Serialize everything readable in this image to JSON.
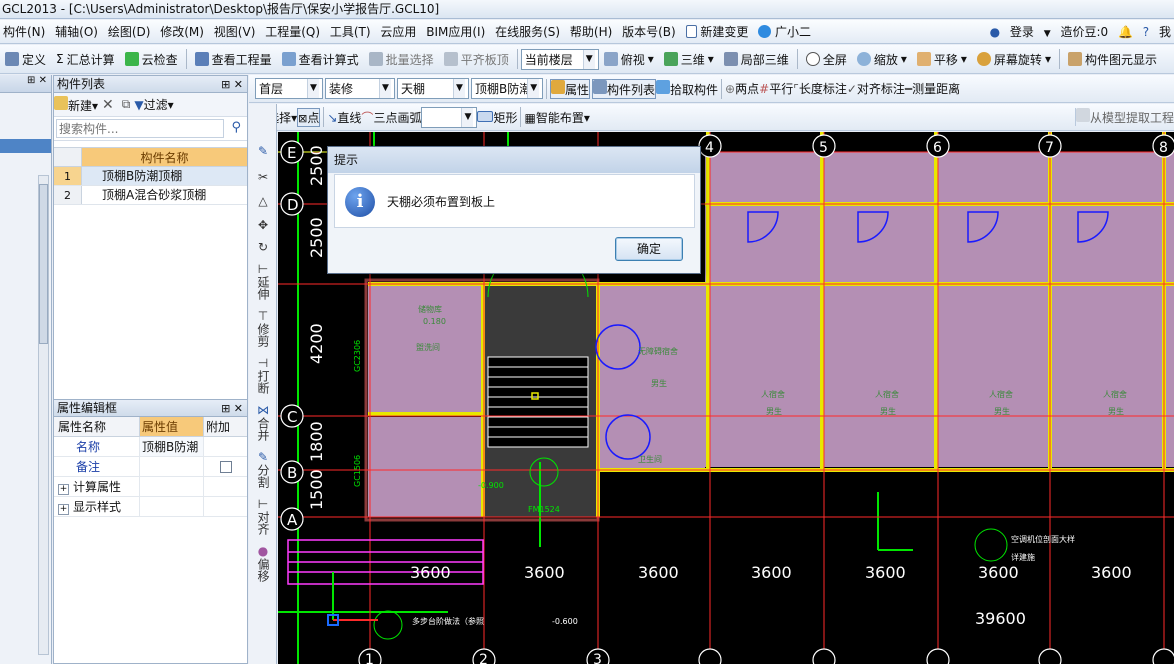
{
  "window": {
    "title": "GCL2013 - [C:\\Users\\Administrator\\Desktop\\报告厅\\保安小学报告厅.GCL10]"
  },
  "menu": {
    "items": [
      "构件(N)",
      "辅轴(O)",
      "绘图(D)",
      "修改(M)",
      "视图(V)",
      "工程量(Q)",
      "工具(T)",
      "云应用",
      "BIM应用(I)",
      "在线服务(S)",
      "帮助(H)",
      "版本号(B)",
      "新建变更",
      "广小二"
    ],
    "login": "登录",
    "cost_beans": "造价豆:0",
    "me": "我"
  },
  "toolbar1": {
    "define": "定义",
    "summary": "汇总计算",
    "cloud_check": "云检查",
    "view_quantity": "查看工程量",
    "view_formula": "查看计算式",
    "batch_select": "批量选择",
    "flush_slab": "平齐板顶",
    "floor_value": "当前楼层",
    "top_view": "俯视",
    "three_d": "三维",
    "partial_3d": "局部三维",
    "full_screen": "全屏",
    "zoom": "缩放",
    "pan": "平移",
    "rotate": "屏幕旋转",
    "component_display": "构件图元显示"
  },
  "toolbar2": {
    "floor": "首层",
    "category": "装修",
    "type": "天棚",
    "component": "顶棚B防潮",
    "properties": "属性",
    "component_list": "构件列表",
    "pick": "拾取构件",
    "two_points": "两点",
    "parallel": "平行",
    "length_mark": "长度标注",
    "align_mark": "对齐标注",
    "measure": "测量距离"
  },
  "toolbar3": {
    "select": "选择",
    "point": "点",
    "line": "直线",
    "three_point_arc": "三点画弧",
    "rect": "矩形",
    "smart_layout": "智能布置",
    "extract_model": "从模型提取工程"
  },
  "component_panel": {
    "title": "构件列表",
    "new": "新建",
    "filter": "过滤",
    "search_placeholder": "搜索构件...",
    "col_name": "构件名称",
    "rows": [
      {
        "no": "1",
        "name": "顶棚B防潮顶棚"
      },
      {
        "no": "2",
        "name": "顶棚A混合砂浆顶棚"
      }
    ]
  },
  "property_panel": {
    "title": "属性编辑框",
    "col_name": "属性名称",
    "col_value": "属性值",
    "col_extra": "附加",
    "rows": [
      {
        "name": "名称",
        "value": "顶棚B防潮"
      },
      {
        "name": "备注",
        "value": ""
      },
      {
        "name": "计算属性",
        "value": ""
      },
      {
        "name": "显示样式",
        "value": ""
      }
    ]
  },
  "vertical_tools": [
    "延伸",
    "修剪",
    "打断",
    "合并",
    "分割",
    "对齐",
    "偏移"
  ],
  "drawing": {
    "axis_x": [
      "1",
      "2",
      "3",
      "4",
      "5",
      "6",
      "7",
      "8"
    ],
    "axis_y": [
      "A",
      "B",
      "C",
      "D",
      "E"
    ],
    "dims_x": [
      "3600",
      "3600",
      "3600",
      "3600",
      "3600",
      "3600",
      "3600"
    ],
    "total_x": "39600",
    "dims_y": [
      "1500",
      "1800",
      "4200",
      "2500",
      "2500"
    ],
    "labels": [
      "储物库",
      "0.180",
      "盥洗间",
      "卫生间",
      "无障碍宿舍",
      "人宿舍",
      "男生",
      "空调机位剖面大样",
      "多步台阶做法（参照",
      "-0.900",
      "-0.600",
      "FM1524",
      "GC2306",
      "GC1506",
      "详建施"
    ]
  },
  "dialog": {
    "title": "提示",
    "message": "天棚必须布置到板上",
    "ok": "确定"
  },
  "colors": {
    "canvas_bg": "#000000",
    "room_fill": "#b48fb4",
    "beam": "#e8e800",
    "grid": "#ff2a2a",
    "wall": "#00e600"
  }
}
